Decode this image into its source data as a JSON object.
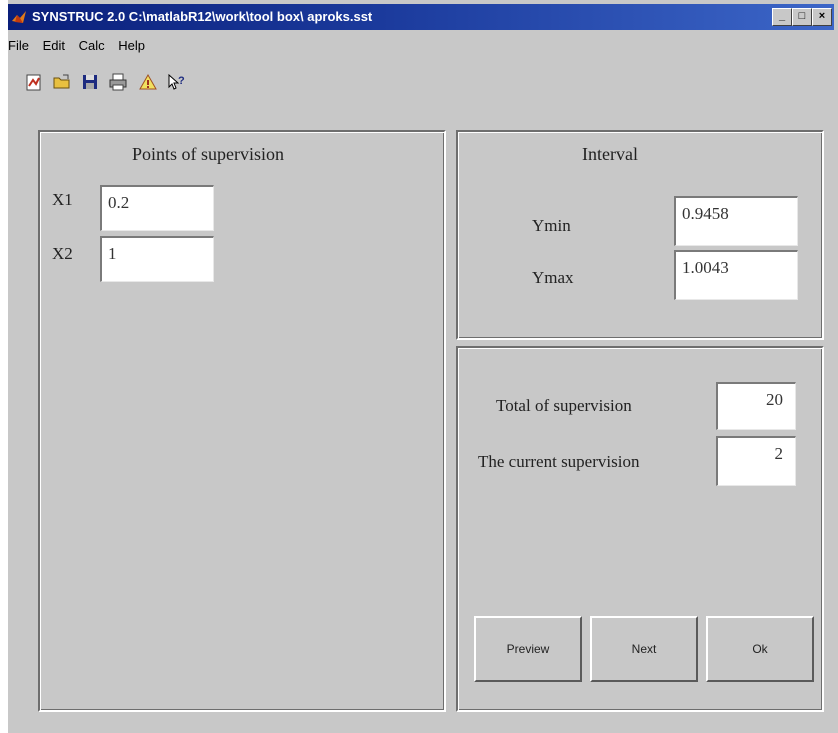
{
  "window": {
    "title": "SYNSTRUC 2.0  C:\\matlabR12\\work\\tool box\\ aproks.sst",
    "controls": {
      "minimize": "_",
      "maximize": "□",
      "close": "×"
    }
  },
  "menu": [
    {
      "label": "File",
      "icon": ""
    },
    {
      "label": "Edit",
      "icon": ""
    },
    {
      "label": "Calc",
      "icon": ""
    },
    {
      "label": "Help",
      "icon": ""
    }
  ],
  "toolbar": {
    "icons": [
      "new-icon",
      "open-folder-icon",
      "save-icon",
      "print-icon",
      "warning-icon",
      "context-help-icon"
    ]
  },
  "points_panel": {
    "title": "Points of supervision",
    "x1_label": "X1",
    "x1_value": "0.2",
    "x2_label": "X2",
    "x2_value": "1"
  },
  "interval_panel": {
    "title": "Interval",
    "ymin_label": "Ymin",
    "ymin_value": "0.9458",
    "ymax_label": "Ymax",
    "ymax_value": "1.0043"
  },
  "supervision_panel": {
    "total_label": "Total of supervision",
    "total_value": "20",
    "current_label": "The current supervision",
    "current_value": "2"
  },
  "buttons": {
    "preview": "Preview",
    "next": "Next",
    "ok": "Ok"
  },
  "colors": {
    "titlebar": "#0a1f7a",
    "face": "#c8c8c8"
  }
}
